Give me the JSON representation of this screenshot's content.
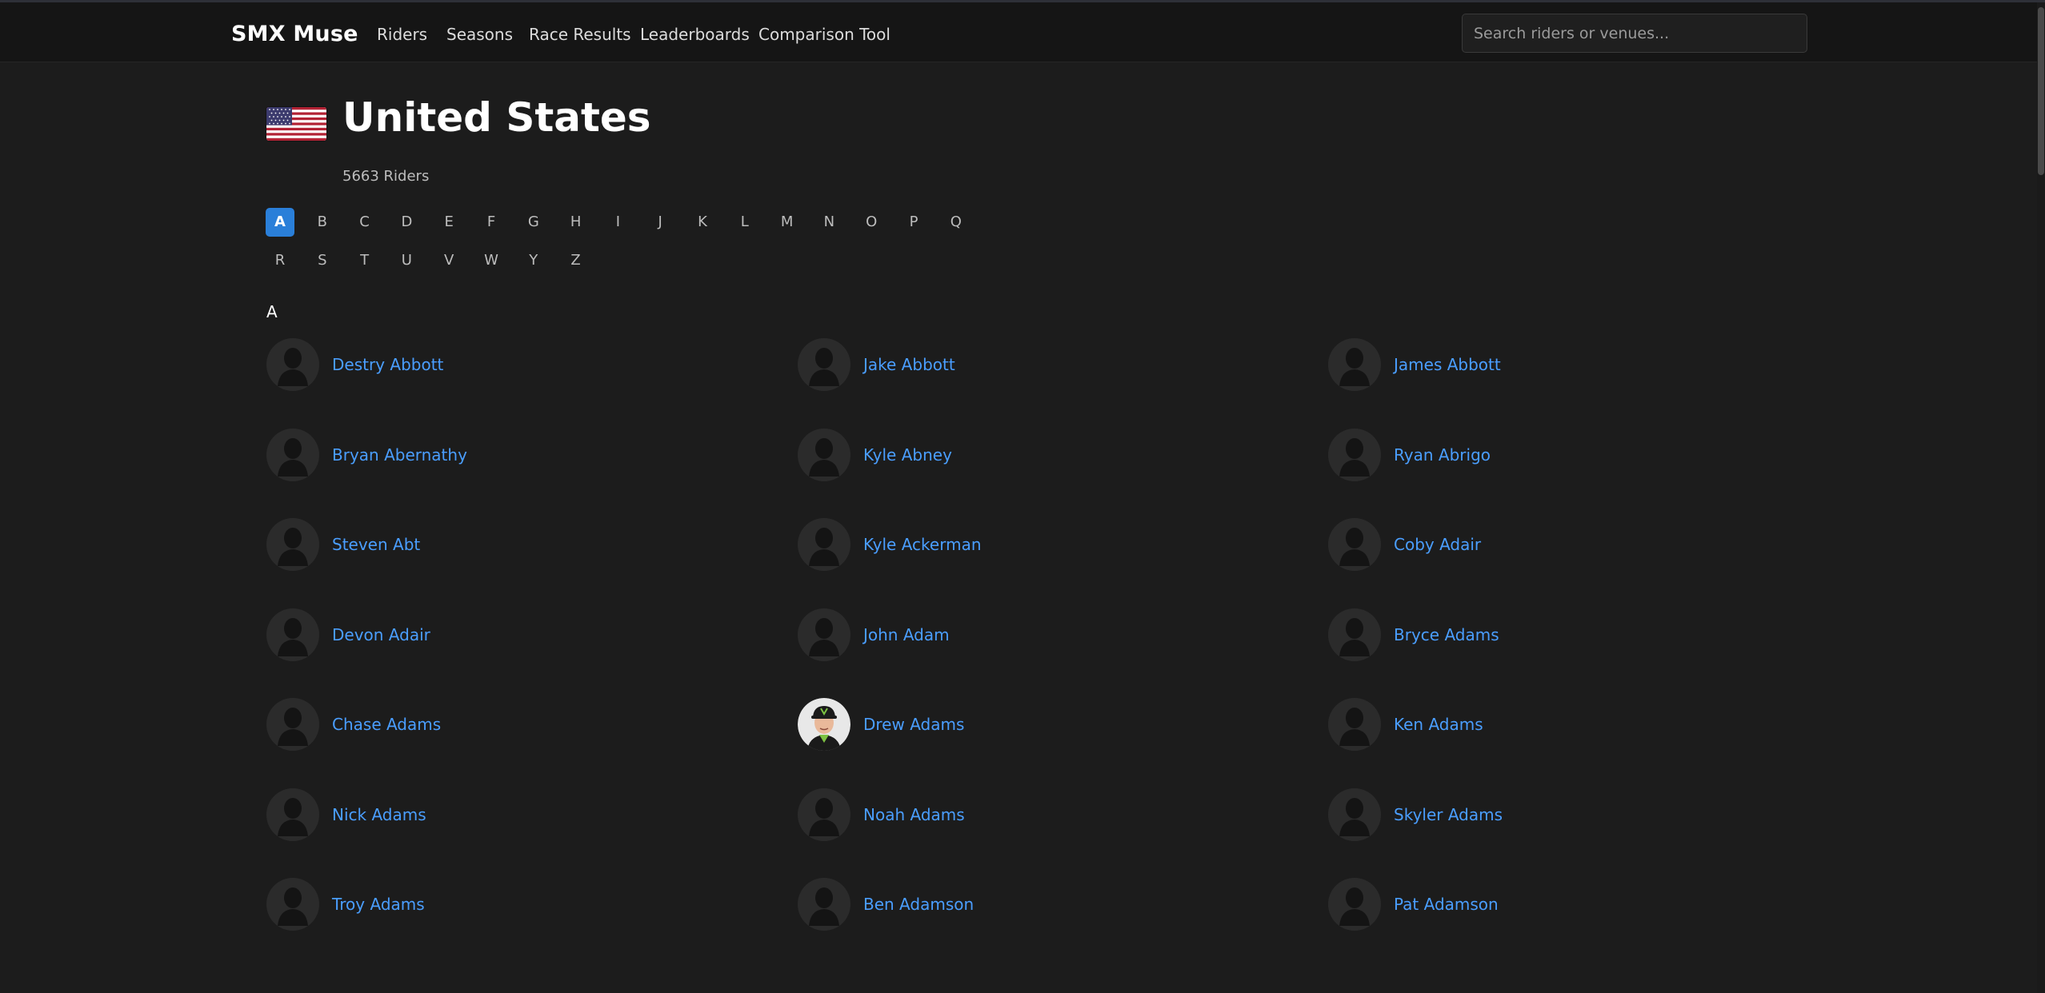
{
  "brand": "SMX Muse",
  "nav": [
    "Riders",
    "Seasons",
    "Race Results",
    "Leaderboards",
    "Comparison Tool"
  ],
  "search": {
    "placeholder": "Search riders or venues..."
  },
  "country": {
    "name": "United States",
    "rider_count": "5663 Riders",
    "flag_icon": "us-flag-icon"
  },
  "letters_row1": [
    "A",
    "B",
    "C",
    "D",
    "E",
    "F",
    "G",
    "H",
    "I",
    "J",
    "K",
    "L",
    "M",
    "N",
    "O",
    "P",
    "Q"
  ],
  "letters_row2": [
    "R",
    "S",
    "T",
    "U",
    "V",
    "W",
    "Y",
    "Z"
  ],
  "active_letter": "A",
  "section_letter": "A",
  "riders": [
    [
      "Destry Abbott",
      "Jake Abbott",
      "James Abbott"
    ],
    [
      "Bryan Abernathy",
      "Kyle Abney",
      "Ryan Abrigo"
    ],
    [
      "Steven Abt",
      "Kyle Ackerman",
      "Coby Adair"
    ],
    [
      "Devon Adair",
      "John Adam",
      "Bryce Adams"
    ],
    [
      "Chase Adams",
      "Drew Adams",
      "Ken Adams"
    ],
    [
      "Nick Adams",
      "Noah Adams",
      "Skyler Adams"
    ],
    [
      "Troy Adams",
      "Ben Adamson",
      "Pat Adamson"
    ]
  ],
  "colors": {
    "link": "#4a9eff",
    "active_letter": "#2a7fd9",
    "background": "#1c1c1c"
  }
}
